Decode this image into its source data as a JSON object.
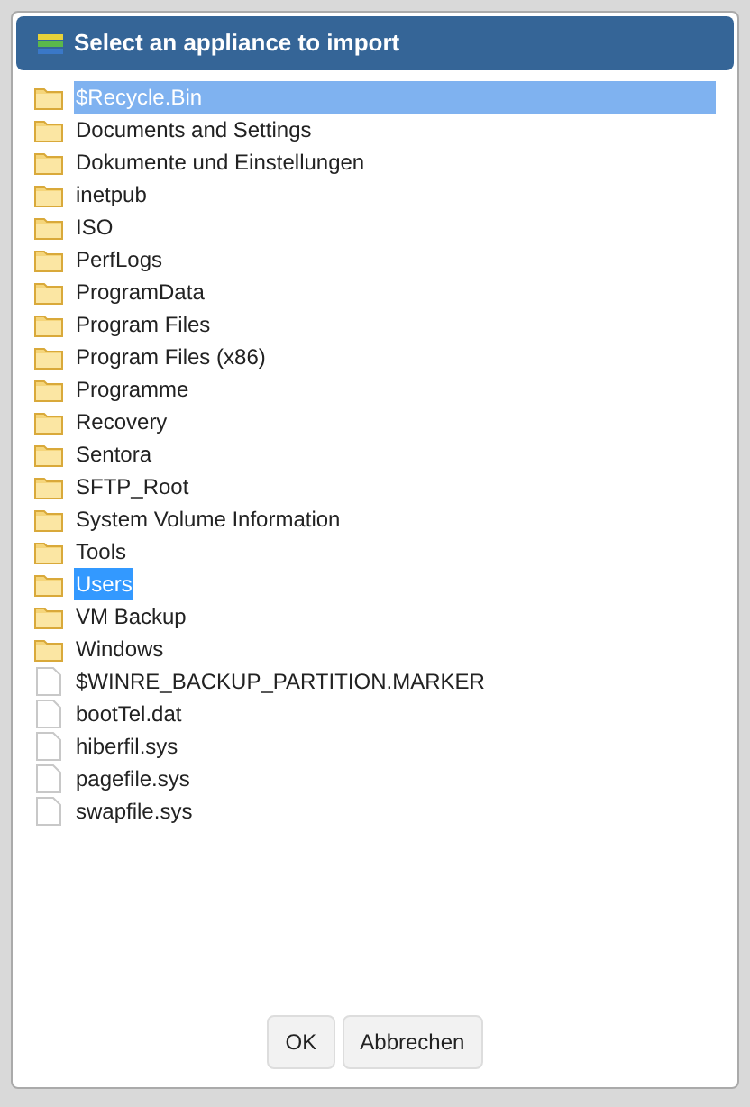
{
  "dialog": {
    "title": "Select an appliance to import"
  },
  "items": [
    {
      "kind": "folder",
      "name": "$Recycle.Bin",
      "hovered": true,
      "selected": false
    },
    {
      "kind": "folder",
      "name": "Documents and Settings",
      "hovered": false,
      "selected": false
    },
    {
      "kind": "folder",
      "name": "Dokumente und Einstellungen",
      "hovered": false,
      "selected": false
    },
    {
      "kind": "folder",
      "name": "inetpub",
      "hovered": false,
      "selected": false
    },
    {
      "kind": "folder",
      "name": "ISO",
      "hovered": false,
      "selected": false
    },
    {
      "kind": "folder",
      "name": "PerfLogs",
      "hovered": false,
      "selected": false
    },
    {
      "kind": "folder",
      "name": "ProgramData",
      "hovered": false,
      "selected": false
    },
    {
      "kind": "folder",
      "name": "Program Files",
      "hovered": false,
      "selected": false
    },
    {
      "kind": "folder",
      "name": "Program Files (x86)",
      "hovered": false,
      "selected": false
    },
    {
      "kind": "folder",
      "name": "Programme",
      "hovered": false,
      "selected": false
    },
    {
      "kind": "folder",
      "name": "Recovery",
      "hovered": false,
      "selected": false
    },
    {
      "kind": "folder",
      "name": "Sentora",
      "hovered": false,
      "selected": false
    },
    {
      "kind": "folder",
      "name": "SFTP_Root",
      "hovered": false,
      "selected": false
    },
    {
      "kind": "folder",
      "name": "System Volume Information",
      "hovered": false,
      "selected": false
    },
    {
      "kind": "folder",
      "name": "Tools",
      "hovered": false,
      "selected": false
    },
    {
      "kind": "folder",
      "name": "Users",
      "hovered": false,
      "selected": true
    },
    {
      "kind": "folder",
      "name": "VM Backup",
      "hovered": false,
      "selected": false
    },
    {
      "kind": "folder",
      "name": "Windows",
      "hovered": false,
      "selected": false
    },
    {
      "kind": "file",
      "name": "$WINRE_BACKUP_PARTITION.MARKER",
      "hovered": false,
      "selected": false
    },
    {
      "kind": "file",
      "name": "bootTel.dat",
      "hovered": false,
      "selected": false
    },
    {
      "kind": "file",
      "name": "hiberfil.sys",
      "hovered": false,
      "selected": false
    },
    {
      "kind": "file",
      "name": "pagefile.sys",
      "hovered": false,
      "selected": false
    },
    {
      "kind": "file",
      "name": "swapfile.sys",
      "hovered": false,
      "selected": false
    }
  ],
  "buttons": [
    "OK",
    "Abbrechen"
  ]
}
